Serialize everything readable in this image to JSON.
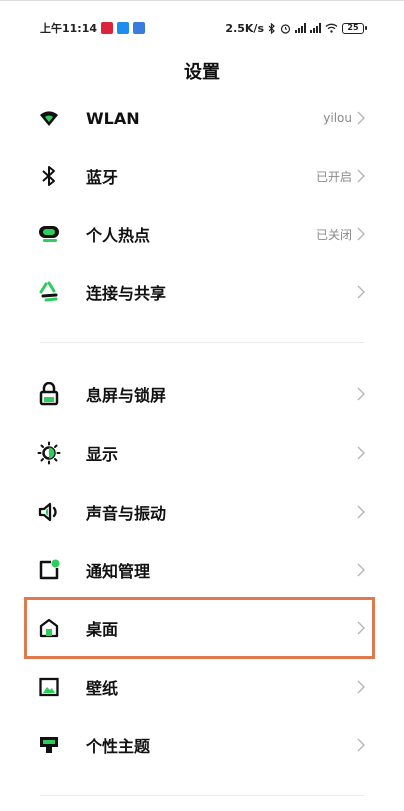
{
  "status": {
    "time": "上午11:14",
    "speed": "2.5K/s",
    "battery": "25"
  },
  "title": "设置",
  "section1": [
    {
      "label": "WLAN",
      "value": "yilou",
      "icon": "wifi-icon"
    },
    {
      "label": "蓝牙",
      "value": "已开启",
      "icon": "bluetooth-icon"
    },
    {
      "label": "个人热点",
      "value": "已关闭",
      "icon": "hotspot-icon"
    },
    {
      "label": "连接与共享",
      "value": "",
      "icon": "share-icon"
    }
  ],
  "section2": [
    {
      "label": "息屏与锁屏",
      "icon": "lock-icon"
    },
    {
      "label": "显示",
      "icon": "brightness-icon"
    },
    {
      "label": "声音与振动",
      "icon": "speaker-icon"
    },
    {
      "label": "通知管理",
      "icon": "notification-icon"
    },
    {
      "label": "桌面",
      "icon": "home-icon"
    },
    {
      "label": "壁纸",
      "icon": "wallpaper-icon"
    },
    {
      "label": "个性主题",
      "icon": "theme-icon"
    }
  ],
  "colors": {
    "accent_green": "#2ecc5c",
    "highlight_orange": "#e07a4e"
  }
}
